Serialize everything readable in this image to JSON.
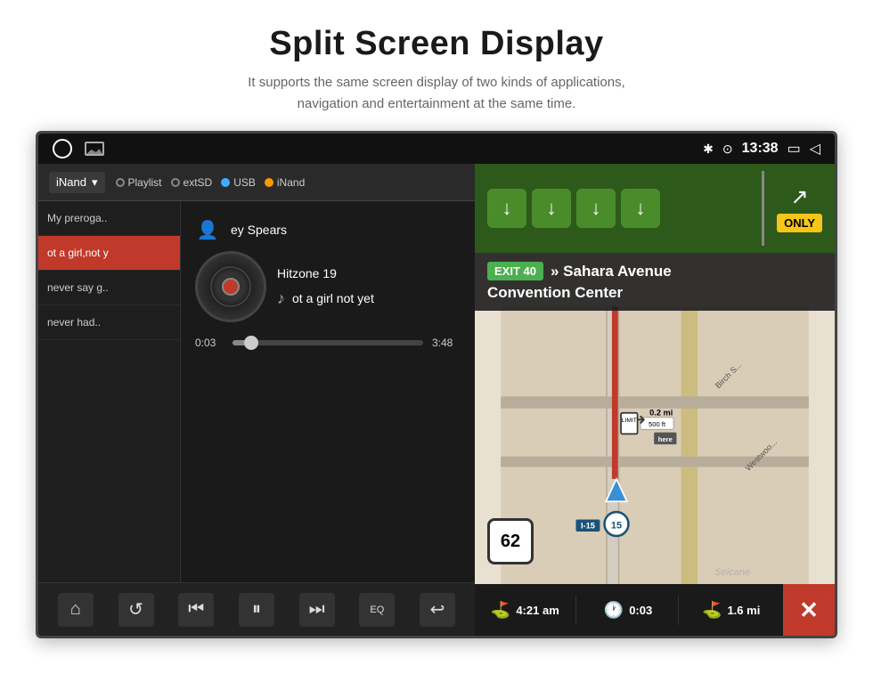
{
  "header": {
    "title": "Split Screen Display",
    "subtitle": "It supports the same screen display of two kinds of applications,\nnavigation and entertainment at the same time."
  },
  "status_bar": {
    "time": "13:38",
    "bluetooth": "✱",
    "location": "⊙"
  },
  "music_player": {
    "source_dropdown": "iNand",
    "sources": [
      "Playlist",
      "extSD",
      "USB",
      "iNand"
    ],
    "tracks": [
      {
        "label": "My preroga..",
        "active": false
      },
      {
        "label": "ot a girl,not y",
        "active": true
      },
      {
        "label": "never say g..",
        "active": false
      },
      {
        "label": "never had..",
        "active": false
      }
    ],
    "artist": "ey Spears",
    "album": "Hitzone 19",
    "song": "ot a girl not yet",
    "time_current": "0:03",
    "time_total": "3:48",
    "controls": {
      "home": "⌂",
      "repeat": "↺",
      "prev": "⏮",
      "play_pause": "⏸",
      "next": "⏭",
      "eq": "EQ",
      "back": "↩"
    }
  },
  "navigation": {
    "arrows": [
      "↓",
      "↓",
      "↓",
      "↓"
    ],
    "only_label": "ONLY",
    "exit_number": "EXIT 40",
    "street_line1": "» Sahara Avenue",
    "street_line2": "Convention Center",
    "speed": "62",
    "highway_name": "I-15",
    "highway_number": "15",
    "distance_ft": "500 ft",
    "distance_mi": "0.2 mi",
    "route_time": "4:21 am",
    "route_segment_time": "0:03",
    "route_segment_dist": "1.6 mi",
    "close_btn": "✕"
  },
  "watermark": "Seicane"
}
